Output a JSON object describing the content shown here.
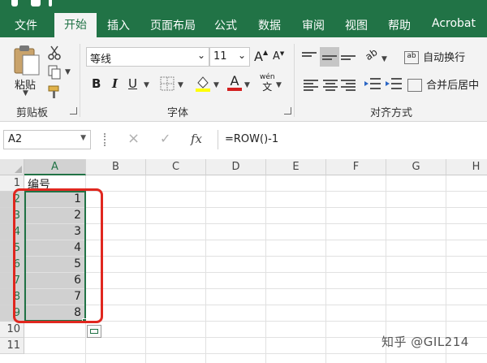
{
  "tabs": [
    {
      "label": "文件"
    },
    {
      "label": "开始"
    },
    {
      "label": "插入"
    },
    {
      "label": "页面布局"
    },
    {
      "label": "公式"
    },
    {
      "label": "数据"
    },
    {
      "label": "审阅"
    },
    {
      "label": "视图"
    },
    {
      "label": "帮助"
    },
    {
      "label": "Acrobat"
    }
  ],
  "ribbon": {
    "clipboard": {
      "paste_label": "粘贴",
      "group_label": "剪贴板",
      "paste_icon": "paste-icon",
      "cut_icon": "scissors-icon",
      "copy_icon": "copy-icon",
      "painter_icon": "format-painter-icon"
    },
    "font": {
      "name": "等线",
      "size": "11",
      "grow_label": "A",
      "shrink_label": "A",
      "bold": "B",
      "italic": "I",
      "underline": "U",
      "font_color_label": "A",
      "pinyin_top": "wén",
      "pinyin_bottom": "文",
      "group_label": "字体",
      "fill_color": "#ffff00",
      "font_color": "#d21f1f"
    },
    "alignment": {
      "wrap_label": "自动换行",
      "merge_label": "合并后居中",
      "group_label": "对齐方式",
      "orientation_label": "ab"
    }
  },
  "formula_bar": {
    "name_box": "A2",
    "cancel_icon": "×",
    "enter_icon": "✓",
    "fx_label": "fx",
    "formula": "=ROW()-1"
  },
  "grid": {
    "columns": [
      "A",
      "B",
      "C",
      "D",
      "E",
      "F",
      "G",
      "H"
    ],
    "rows": [
      "1",
      "2",
      "3",
      "4",
      "5",
      "6",
      "7",
      "8",
      "9",
      "10",
      "11"
    ],
    "cells": {
      "A1": "编号",
      "A2": "1",
      "A3": "2",
      "A4": "3",
      "A5": "4",
      "A6": "5",
      "A7": "6",
      "A8": "7",
      "A9": "8"
    },
    "selection": "A2:A9"
  },
  "watermark": "知乎 @GIL214",
  "colors": {
    "brand_green": "#217346",
    "highlight_red": "#e0271f",
    "selection_fill": "#d0d0d0"
  }
}
